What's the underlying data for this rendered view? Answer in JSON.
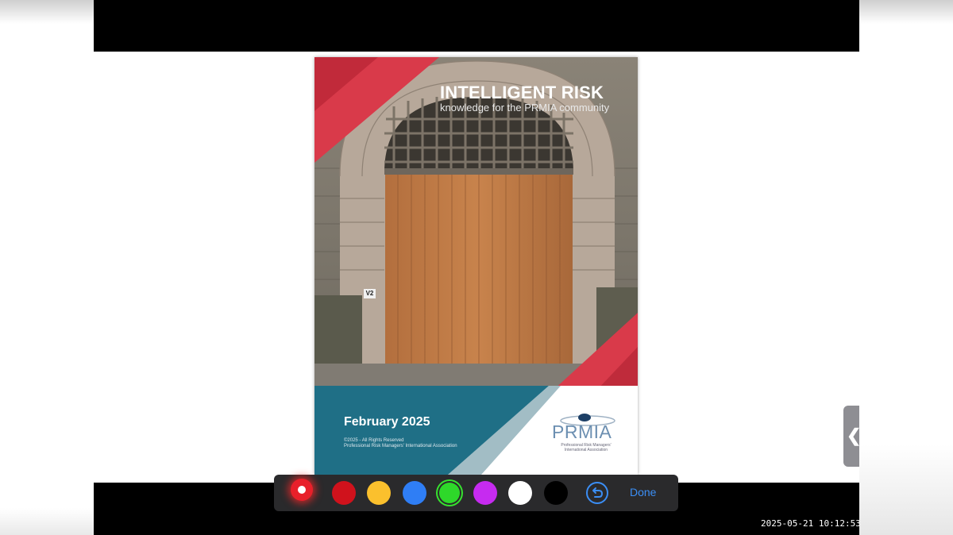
{
  "cover": {
    "title": "INTELLIGENT RISK",
    "subtitle": "knowledge for the PRMIA community",
    "door_sign": "V2",
    "date": "February 2025",
    "copyright_line1": "©2025 - All Rights Reserved",
    "copyright_line2": "Professional Risk Managers' International Association",
    "logo_text": "PRMIA",
    "logo_sub_line1": "Professional Risk Managers'",
    "logo_sub_line2": "International Association"
  },
  "toolbar": {
    "swatches": [
      {
        "name": "red-pen",
        "color": "#e8202a",
        "state": "active"
      },
      {
        "name": "red",
        "color": "#d0121c"
      },
      {
        "name": "yellow",
        "color": "#fbc02d"
      },
      {
        "name": "blue",
        "color": "#2f7ef5"
      },
      {
        "name": "green",
        "color": "#2ed82a",
        "state": "selected"
      },
      {
        "name": "purple",
        "color": "#c62bf0"
      },
      {
        "name": "white",
        "color": "#ffffff"
      },
      {
        "name": "black",
        "color": "#000000"
      }
    ],
    "undo_icon": "undo-circle-arrow-icon",
    "done_label": "Done"
  },
  "side_handle_icon": "chevron-left-icon",
  "side_handle_glyph": "❮",
  "timestamp": "2025-05-21  10:12:53",
  "colors": {
    "accent_red": "#d93a4a",
    "teal": "#1f6f86",
    "toolbar_bg": "#2a2a2c",
    "done_blue": "#3b8ef5"
  }
}
